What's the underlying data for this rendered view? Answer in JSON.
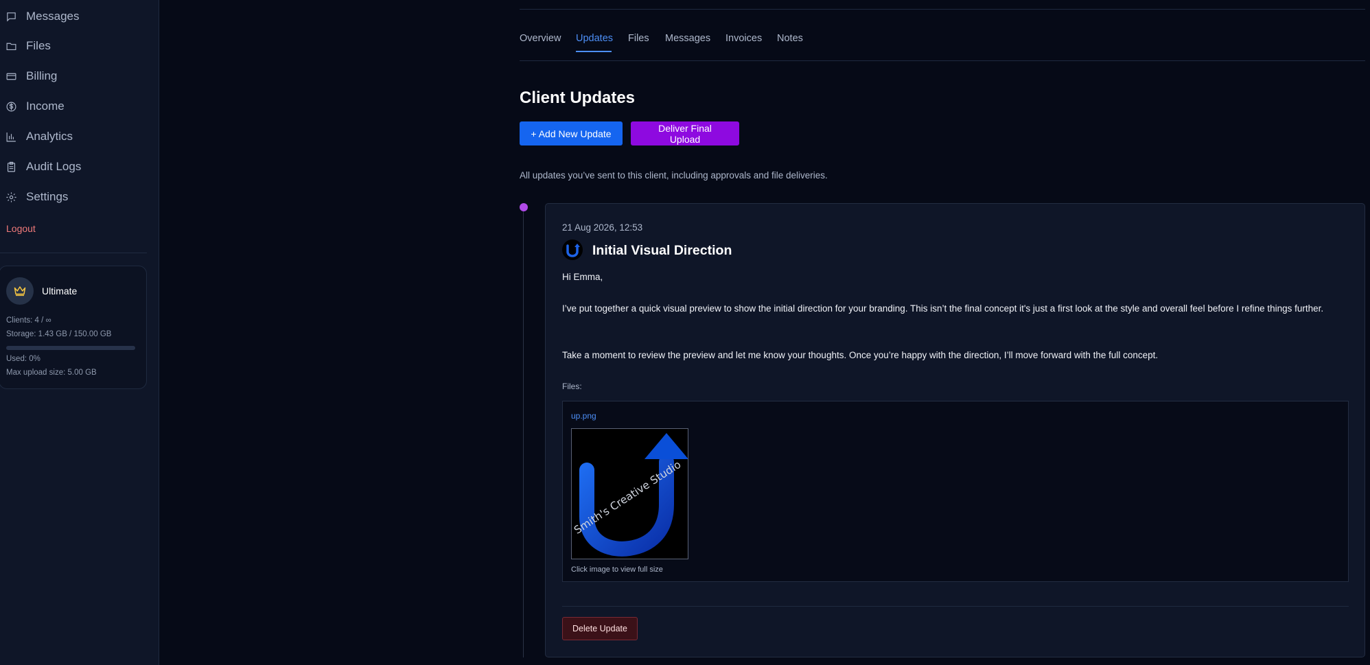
{
  "sidebar": {
    "items": [
      {
        "label": "Messages",
        "icon": "message-icon"
      },
      {
        "label": "Files",
        "icon": "folder-icon"
      },
      {
        "label": "Billing",
        "icon": "credit-card-icon"
      },
      {
        "label": "Income",
        "icon": "dollar-circle-icon"
      },
      {
        "label": "Analytics",
        "icon": "bar-chart-icon"
      },
      {
        "label": "Audit Logs",
        "icon": "clipboard-icon"
      },
      {
        "label": "Settings",
        "icon": "gear-icon"
      }
    ],
    "logout_label": "Logout",
    "plan": {
      "name": "Ultimate",
      "icon": "crown-icon",
      "clients": "Clients: 4 / ∞",
      "storage": "Storage: 1.43 GB / 150.00 GB",
      "used": "Used: 0%",
      "used_fraction": 0.0,
      "max_upload": "Max upload size: 5.00 GB"
    }
  },
  "tabs": [
    {
      "label": "Overview"
    },
    {
      "label": "Updates",
      "active": true
    },
    {
      "label": "Files"
    },
    {
      "label": "Messages"
    },
    {
      "label": "Invoices"
    },
    {
      "label": "Notes"
    }
  ],
  "page": {
    "title": "Client Updates",
    "add_button": "+ Add New Update",
    "deliver_button": "Deliver Final Upload",
    "description": "All updates you’ve sent to this client, including approvals and file deliveries."
  },
  "update": {
    "date": "21 Aug 2026, 12:53",
    "title": "Initial Visual Direction",
    "greeting": "Hi Emma,",
    "paragraph1": "I’ve put together a quick visual preview to show the initial direction for your branding. This isn’t the final concept it's just a first look at the style and overall feel before I refine things further.",
    "paragraph2": "Take a moment to review the preview and let me know your thoughts. Once you’re happy with the direction, I’ll move forward with the full concept.",
    "files_label": "Files:",
    "file": {
      "name": "up.png",
      "image_text": "Smith's Creative Studio",
      "caption": "Click image to view full size"
    },
    "delete_button": "Delete Update"
  },
  "colors": {
    "accent": "#4d8ff7",
    "add_button": "#1565f0",
    "deliver_button": "#8e0ae0",
    "timeline_dot": "#b04ae8",
    "logout": "#f07a7a",
    "background": "#060a17",
    "sidebar": "#0f1628"
  }
}
